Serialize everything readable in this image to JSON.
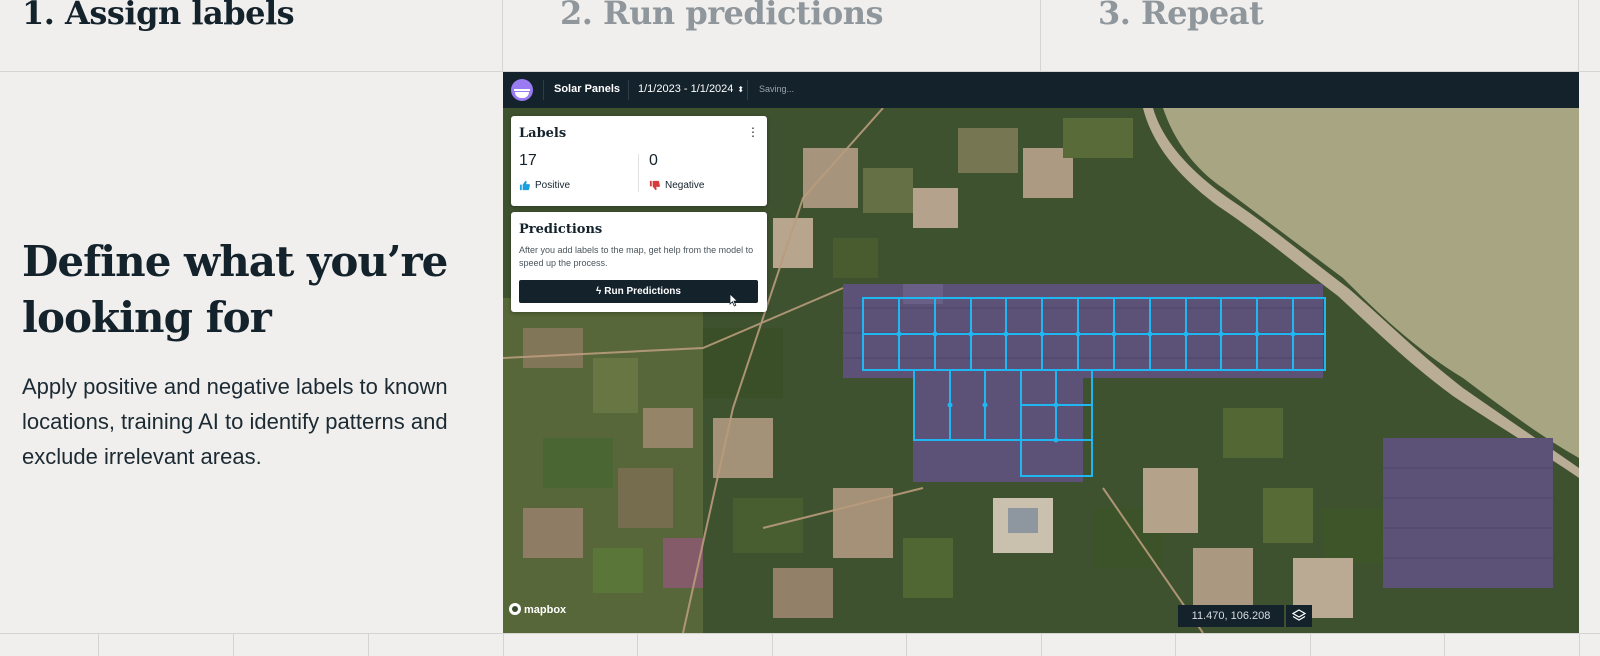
{
  "steps": [
    {
      "label": "1. Assign labels",
      "active": true
    },
    {
      "label": "2. Run predictions",
      "active": false
    },
    {
      "label": "3. Repeat",
      "active": false
    }
  ],
  "intro": {
    "headline": "Define what you’re looking for",
    "body": "Apply positive and negative labels to known locations, training AI to identify patterns and exclude irrelevant areas."
  },
  "app": {
    "project_name": "Solar Panels",
    "date_range": "1/1/2023 - 1/1/2024",
    "date_range_icon": "chevron-up-down-icon",
    "status": "Saving...",
    "labels_panel": {
      "title": "Labels",
      "positive_count": "17",
      "positive_label": "Positive",
      "negative_count": "0",
      "negative_label": "Negative"
    },
    "predictions_panel": {
      "title": "Predictions",
      "description": "After you add labels to the map, get help from the model to speed up the process.",
      "button_label": "Run Predictions"
    },
    "map": {
      "attribution": "mapbox",
      "coordinates": "11.470, 106.208",
      "label_outline_color": "#1fb6f2",
      "positive_color": "#1a9fe0",
      "negative_color": "#d63a3a"
    }
  },
  "colors": {
    "page_bg": "#f0efed",
    "ink": "#14222c",
    "muted_step": "#8f979c",
    "accent_logo": "#9b7bf2"
  }
}
